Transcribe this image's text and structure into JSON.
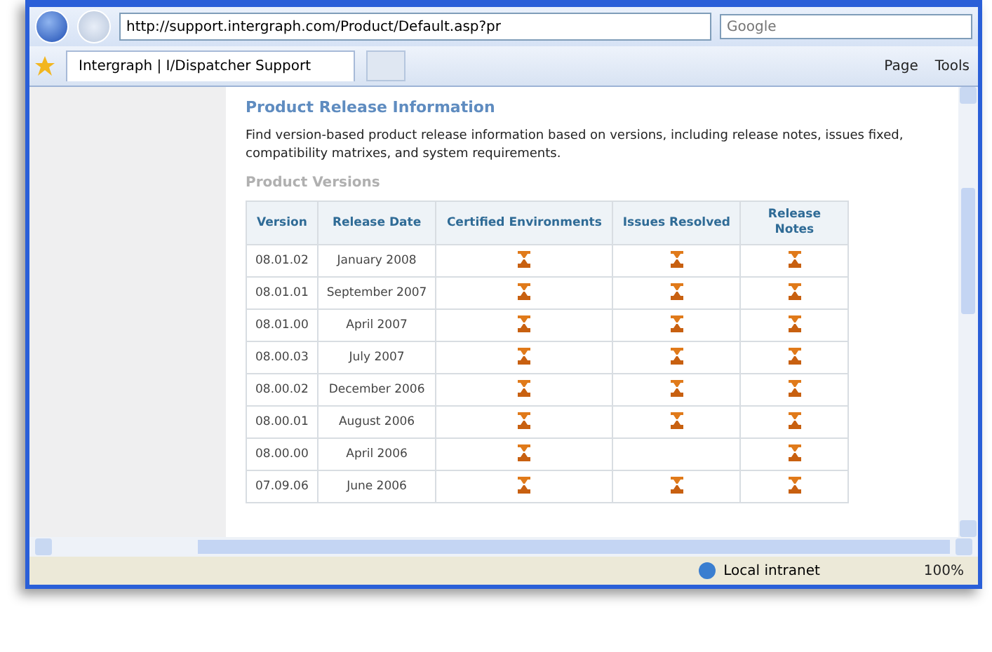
{
  "browser": {
    "address": "http://support.intergraph.com/Product/Default.asp?pr",
    "search": {
      "placeholder": "Google"
    },
    "tab": {
      "label": "Intergraph | I/Dispatcher Support",
      "selected": true
    },
    "toolbar": [
      "Page",
      "Tools"
    ]
  },
  "page": {
    "heading": "Product Release Information",
    "intro": "Find version-based product release information based on versions, including release notes, issues fixed, compatibility matrixes, and system requirements.",
    "subheading": "Product Versions",
    "table": {
      "columns": [
        "Version",
        "Release Date",
        "Certified Environments",
        "Issues Resolved",
        "Release Notes"
      ],
      "rows": [
        {
          "version": "08.01.02",
          "date": "January 2008",
          "certified": true,
          "issues": true,
          "notes": true
        },
        {
          "version": "08.01.01",
          "date": "September 2007",
          "certified": true,
          "issues": true,
          "notes": true
        },
        {
          "version": "08.01.00",
          "date": "April 2007",
          "certified": true,
          "issues": true,
          "notes": true
        },
        {
          "version": "08.00.03",
          "date": "July 2007",
          "certified": true,
          "issues": true,
          "notes": true
        },
        {
          "version": "08.00.02",
          "date": "December 2006",
          "certified": true,
          "issues": true,
          "notes": true
        },
        {
          "version": "08.00.01",
          "date": "August 2006",
          "certified": true,
          "issues": true,
          "notes": true
        },
        {
          "version": "08.00.00",
          "date": "April 2006",
          "certified": true,
          "issues": false,
          "notes": true
        },
        {
          "version": "07.09.06",
          "date": "June 2006",
          "certified": true,
          "issues": true,
          "notes": true
        }
      ]
    }
  },
  "status_bar": {
    "zone": "Local intranet",
    "zoom": "100%"
  }
}
